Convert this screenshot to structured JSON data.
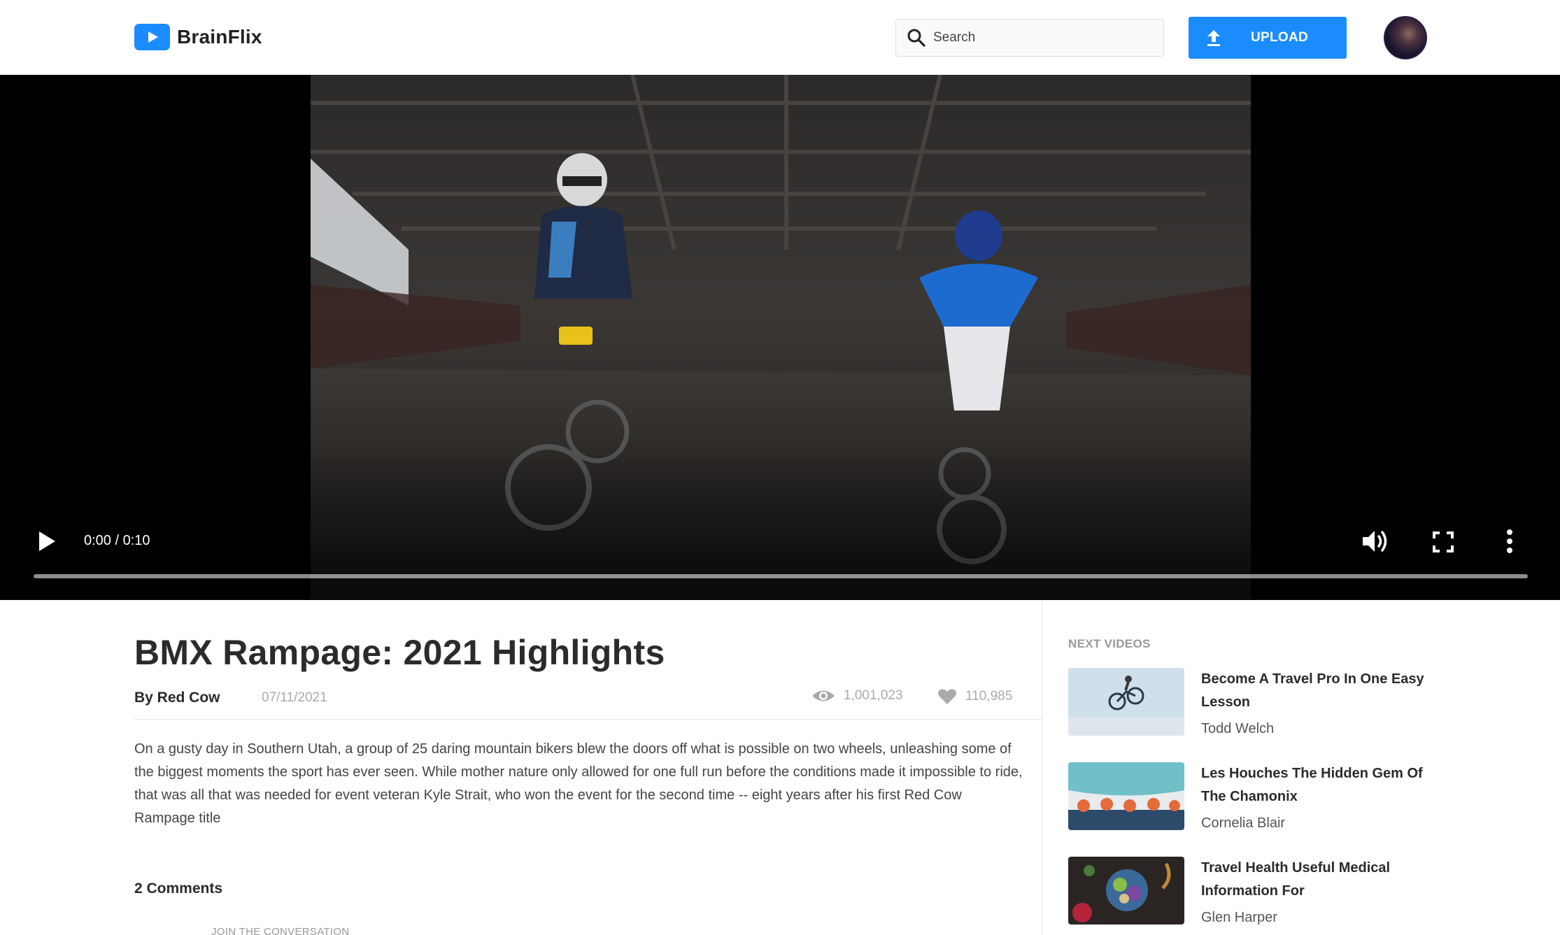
{
  "header": {
    "brand": "BrainFlix",
    "search_placeholder": "Search",
    "upload_label": "UPLOAD"
  },
  "player": {
    "timecode": "0:00 / 0:10",
    "progress_fraction": 0
  },
  "video": {
    "title": "BMX Rampage: 2021 Highlights",
    "author": "By Red Cow",
    "date": "07/11/2021",
    "views": "1,001,023",
    "likes": "110,985",
    "description": "On a gusty day in Southern Utah, a group of 25 daring mountain bikers blew the doors off what is possible on two wheels, unleashing some of the biggest moments the sport has ever seen. While mother nature only allowed for one full run before the conditions made it impossible to ride, that was all that was needed for event veteran Kyle Strait, who won the event for the second time -- eight years after his first Red Cow Rampage title"
  },
  "comments": {
    "count_label": "2 Comments",
    "join_label": "JOIN THE CONVERSATION"
  },
  "sidebar": {
    "heading": "NEXT VIDEOS",
    "items": [
      {
        "title": "Become A Travel Pro In One Easy Lesson",
        "author": "Todd Welch"
      },
      {
        "title": "Les Houches The Hidden Gem Of The Chamonix",
        "author": "Cornelia Blair"
      },
      {
        "title": "Travel Health Useful Medical Information For",
        "author": "Glen Harper"
      }
    ]
  },
  "colors": {
    "accent": "#1a8cff",
    "player_bg": "#000000"
  },
  "icons": [
    "play-icon",
    "search-icon",
    "upload-icon",
    "volume-icon",
    "fullscreen-icon",
    "more-icon",
    "views-icon",
    "likes-icon"
  ]
}
